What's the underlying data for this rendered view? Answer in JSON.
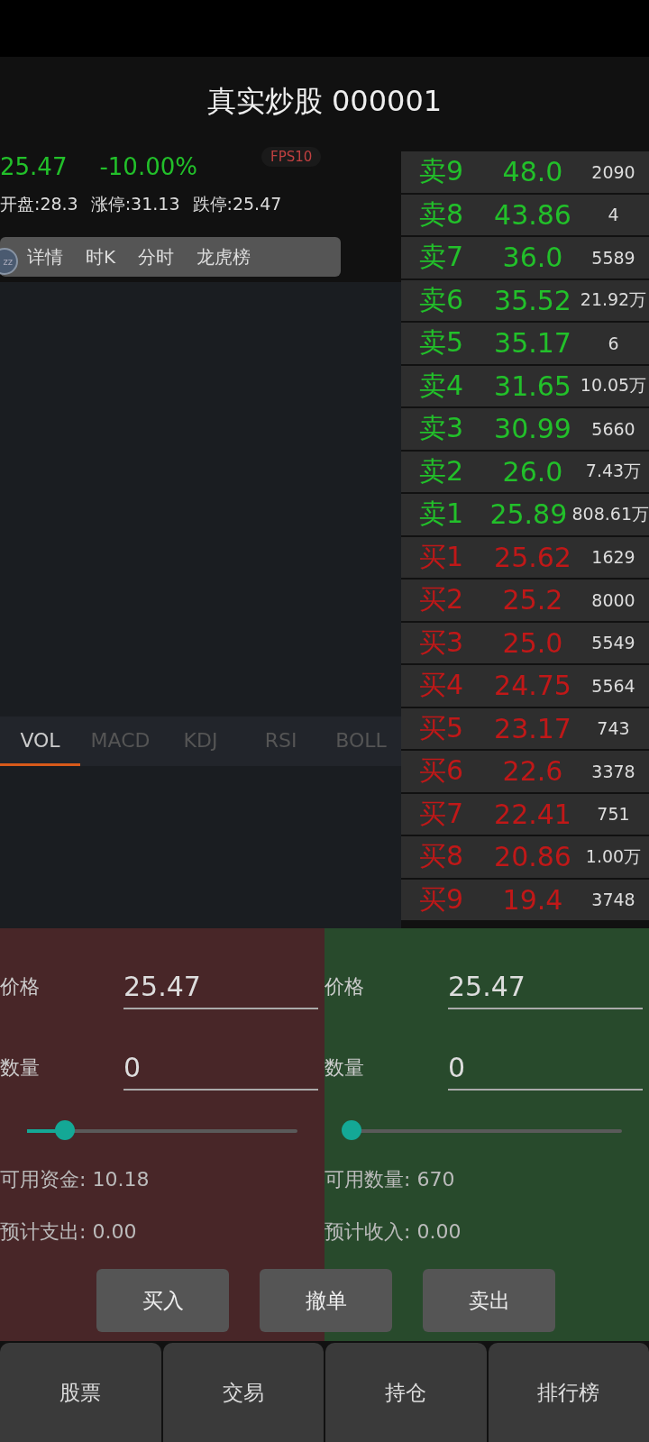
{
  "title": "真实炒股 000001",
  "quote": {
    "price": "25.47",
    "change": "-10.00%",
    "fps": "FPS10",
    "open": "开盘:28.3",
    "limit_up": "涨停:31.13",
    "limit_down": "跌停:25.47"
  },
  "float_badge": "zz",
  "tabs": [
    {
      "label": "详情",
      "selected": false
    },
    {
      "label": "时K",
      "selected": false
    },
    {
      "label": "分时",
      "selected": false
    },
    {
      "label": "龙虎榜",
      "selected": false
    }
  ],
  "indicator_tabs": [
    {
      "label": "VOL",
      "selected": true
    },
    {
      "label": "MACD",
      "selected": false
    },
    {
      "label": "KDJ",
      "selected": false
    },
    {
      "label": "RSI",
      "selected": false
    },
    {
      "label": "BOLL",
      "selected": false
    }
  ],
  "order_book": [
    {
      "kind": "sell",
      "label": "卖9",
      "price": "48.0",
      "volume": "2090"
    },
    {
      "kind": "sell",
      "label": "卖8",
      "price": "43.86",
      "volume": "4"
    },
    {
      "kind": "sell",
      "label": "卖7",
      "price": "36.0",
      "volume": "5589"
    },
    {
      "kind": "sell",
      "label": "卖6",
      "price": "35.52",
      "volume": "21.92万"
    },
    {
      "kind": "sell",
      "label": "卖5",
      "price": "35.17",
      "volume": "6"
    },
    {
      "kind": "sell",
      "label": "卖4",
      "price": "31.65",
      "volume": "10.05万"
    },
    {
      "kind": "sell",
      "label": "卖3",
      "price": "30.99",
      "volume": "5660"
    },
    {
      "kind": "sell",
      "label": "卖2",
      "price": "26.0",
      "volume": "7.43万"
    },
    {
      "kind": "sell",
      "label": "卖1",
      "price": "25.89",
      "volume": "808.61万"
    },
    {
      "kind": "buy",
      "label": "买1",
      "price": "25.62",
      "volume": "1629"
    },
    {
      "kind": "buy",
      "label": "买2",
      "price": "25.2",
      "volume": "8000"
    },
    {
      "kind": "buy",
      "label": "买3",
      "price": "25.0",
      "volume": "5549"
    },
    {
      "kind": "buy",
      "label": "买4",
      "price": "24.75",
      "volume": "5564"
    },
    {
      "kind": "buy",
      "label": "买5",
      "price": "23.17",
      "volume": "743"
    },
    {
      "kind": "buy",
      "label": "买6",
      "price": "22.6",
      "volume": "3378"
    },
    {
      "kind": "buy",
      "label": "买7",
      "price": "22.41",
      "volume": "751"
    },
    {
      "kind": "buy",
      "label": "买8",
      "price": "20.86",
      "volume": "1.00万"
    },
    {
      "kind": "buy",
      "label": "买9",
      "price": "19.4",
      "volume": "3748"
    }
  ],
  "trade_panels": [
    {
      "kind": "buy",
      "price_label": "价格",
      "price": "25.47",
      "qty_label": "数量",
      "qty": "0",
      "level": 0.14,
      "available": "可用资金: 10.18",
      "estimate": "预计支出: 0.00"
    },
    {
      "kind": "sell",
      "price_label": "价格",
      "price": "25.47",
      "qty_label": "数量",
      "qty": "0",
      "level": 0,
      "available": "可用数量: 670",
      "estimate": "预计收入: 0.00"
    }
  ],
  "actions": [
    "买入",
    "撤单",
    "卖出"
  ],
  "nav": [
    {
      "label": "股票",
      "selected": false
    },
    {
      "label": "交易",
      "selected": false
    },
    {
      "label": "持仓",
      "selected": false
    },
    {
      "label": "排行榜",
      "selected": false
    }
  ]
}
